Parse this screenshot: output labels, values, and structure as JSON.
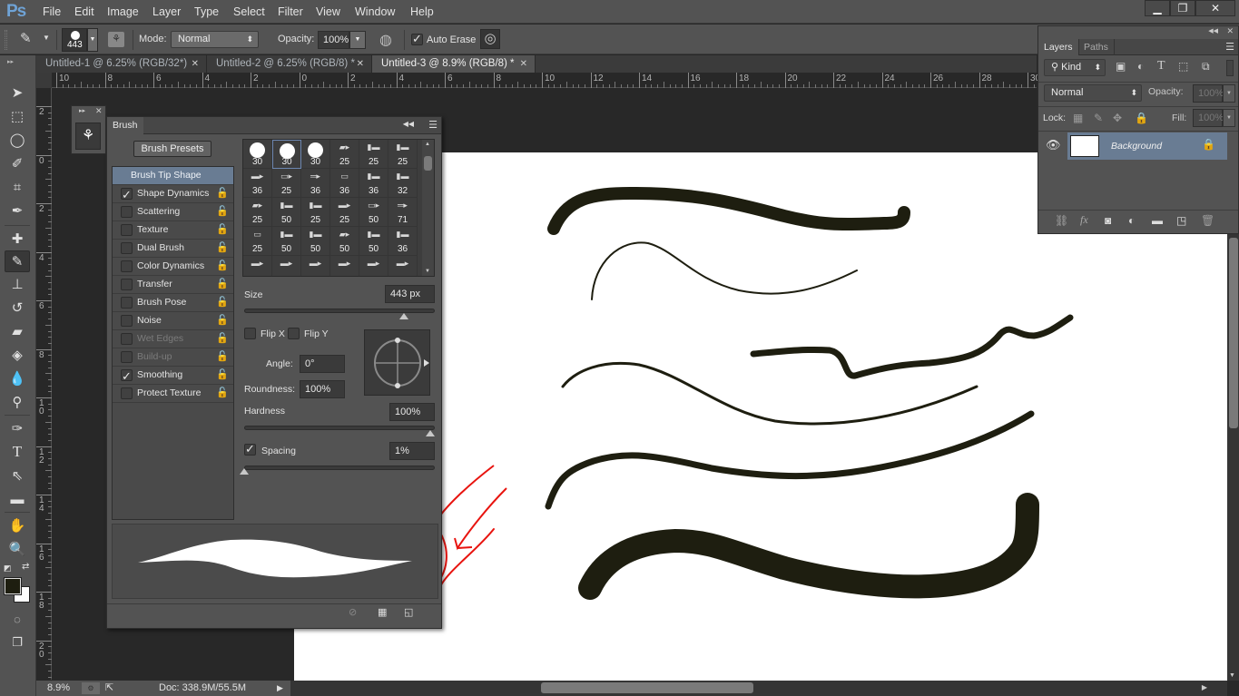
{
  "app": {
    "logo": "Ps"
  },
  "menu": [
    "File",
    "Edit",
    "Image",
    "Layer",
    "Type",
    "Select",
    "Filter",
    "View",
    "Window",
    "Help"
  ],
  "window_controls": {
    "minimize": "▁",
    "restore": "❐",
    "close": "✕"
  },
  "options_bar": {
    "brush_size": "443",
    "mode_label": "Mode:",
    "mode_value": "Normal",
    "opacity_label": "Opacity:",
    "opacity_value": "100%",
    "auto_erase_label": "Auto Erase",
    "auto_erase_checked": true
  },
  "doc_tabs": [
    {
      "label": "Untitled-1 @ 6.25% (RGB/32*)",
      "active": false
    },
    {
      "label": "Untitled-2 @ 6.25% (RGB/8) *",
      "active": false
    },
    {
      "label": "Untitled-3 @ 8.9% (RGB/8) *",
      "active": true
    }
  ],
  "rulers": {
    "horizontal": [
      "10",
      "8",
      "6",
      "4",
      "2",
      "0",
      "2",
      "4",
      "6",
      "8",
      "10",
      "12",
      "14",
      "16",
      "18",
      "20",
      "22",
      "24",
      "26",
      "28",
      "30"
    ],
    "vertical": [
      "2",
      "0",
      "2",
      "4",
      "6",
      "8",
      "10",
      "12",
      "14",
      "16",
      "18",
      "20"
    ]
  },
  "tools": [
    "move",
    "marquee",
    "lasso",
    "quick-select",
    "crop",
    "eyedropper",
    "healing",
    "pencil",
    "stamp",
    "history-brush",
    "eraser",
    "paint-bucket",
    "blur",
    "dodge",
    "pen",
    "type",
    "path-select",
    "rectangle",
    "hand",
    "zoom"
  ],
  "colors": {
    "foreground": "#1e1e10",
    "background": "#ffffff",
    "stroke": "#1e1e10",
    "annotation": "#e8140f",
    "selection": "#697c93"
  },
  "brush_panel": {
    "tab": "Brush",
    "presets_button": "Brush Presets",
    "options": [
      {
        "label": "Brush Tip Shape",
        "selected": true,
        "checkbox": false
      },
      {
        "label": "Shape Dynamics",
        "checked": true,
        "locked": true
      },
      {
        "label": "Scattering",
        "checked": false,
        "locked": true
      },
      {
        "label": "Texture",
        "checked": false,
        "locked": true
      },
      {
        "label": "Dual Brush",
        "checked": false,
        "locked": true
      },
      {
        "label": "Color Dynamics",
        "checked": false,
        "locked": true
      },
      {
        "label": "Transfer",
        "checked": false,
        "locked": true
      },
      {
        "label": "Brush Pose",
        "checked": false,
        "locked": true
      },
      {
        "label": "Noise",
        "checked": false,
        "locked": true
      },
      {
        "label": "Wet Edges",
        "checked": false,
        "disabled": true
      },
      {
        "label": "Build-up",
        "checked": false,
        "disabled": true
      },
      {
        "label": "Smoothing",
        "checked": true,
        "locked": true
      },
      {
        "label": "Protect Texture",
        "checked": false,
        "locked": true
      }
    ],
    "tip_sizes": [
      "30",
      "30",
      "30",
      "25",
      "25",
      "25",
      "36",
      "25",
      "36",
      "36",
      "36",
      "32",
      "25",
      "50",
      "25",
      "25",
      "50",
      "71",
      "25",
      "50",
      "50",
      "50",
      "50",
      "36"
    ],
    "selected_tip_index": 1,
    "size_label": "Size",
    "size_value": "443 px",
    "size_fraction": 0.86,
    "flip_x": "Flip X",
    "flip_y": "Flip Y",
    "angle_label": "Angle:",
    "angle_value": "0°",
    "roundness_label": "Roundness:",
    "roundness_value": "100%",
    "hardness_label": "Hardness",
    "hardness_value": "100%",
    "hardness_fraction": 1.0,
    "spacing_label": "Spacing",
    "spacing_checked": true,
    "spacing_value": "1%",
    "spacing_fraction": 0.0
  },
  "layers_panel": {
    "tabs": [
      "Layers",
      "Paths"
    ],
    "filter_label": "Kind",
    "blend_mode": "Normal",
    "opacity_label": "Opacity:",
    "opacity_value": "100%",
    "lock_label": "Lock:",
    "fill_label": "Fill:",
    "fill_value": "100%",
    "layers": [
      {
        "name": "Background",
        "visible": true,
        "locked": true
      }
    ]
  },
  "status": {
    "zoom": "8.9%",
    "doc": "Doc: 338.9M/55.5M"
  }
}
